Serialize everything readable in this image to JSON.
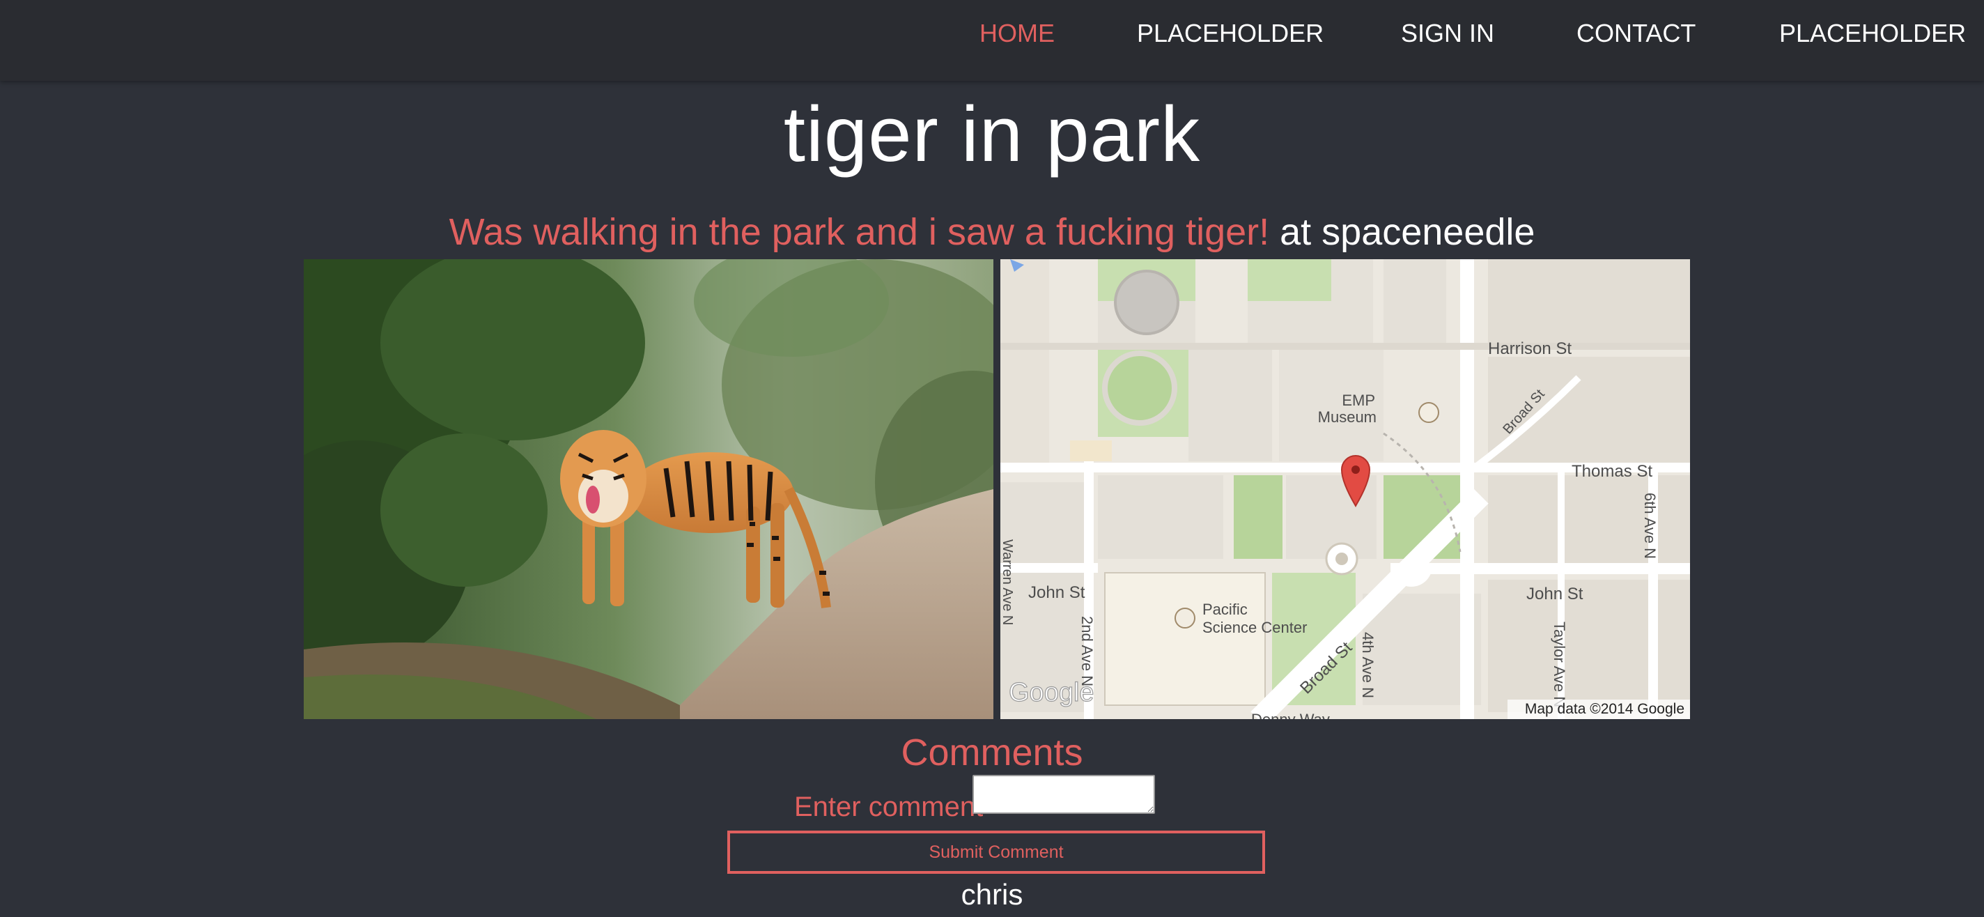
{
  "nav": {
    "items": [
      {
        "label": "HOME",
        "active": true
      },
      {
        "label": "PLACEHOLDER",
        "active": false
      },
      {
        "label": "SIGN IN",
        "active": false
      },
      {
        "label": "CONTACT",
        "active": false
      },
      {
        "label": "PLACEHOLDER",
        "active": false
      }
    ]
  },
  "post": {
    "title": "tiger in park",
    "description": "Was walking in the park and i saw a fucking tiger!",
    "location": "at spaceneedle"
  },
  "map": {
    "streets": {
      "harrison": "Harrison St",
      "thomas": "Thomas St",
      "john_left": "John St",
      "john_right": "John St",
      "broad_upper": "Broad St",
      "broad_lower": "Broad St",
      "sixth_ave": "6th Ave N",
      "fourth_ave": "4th Ave N",
      "second_ave": "2nd Ave N",
      "taylor_ave": "Taylor Ave N",
      "warren_ave": "Warren Ave N",
      "denny_way": "Denny Way"
    },
    "places": {
      "emp_line1": "EMP",
      "emp_line2": "Museum",
      "pacific_line1": "Pacific",
      "pacific_line2": "Science Center"
    },
    "logo": "Google",
    "attribution": "Map data ©2014 Google"
  },
  "comments": {
    "heading": "Comments",
    "input_label": "Enter comment",
    "input_value": "",
    "submit_label": "Submit Comment",
    "list": [
      {
        "author": "chris"
      }
    ]
  },
  "colors": {
    "accent": "#e0605f",
    "background": "#2e3139",
    "navbar": "#2a2c31"
  }
}
